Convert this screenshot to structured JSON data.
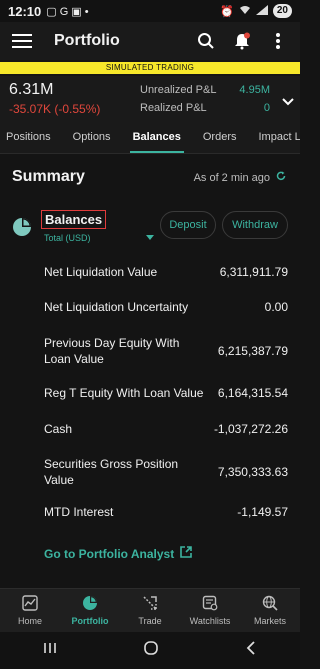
{
  "status_bar": {
    "time": "12:10",
    "battery": "20"
  },
  "app_bar": {
    "title": "Portfolio",
    "icons": [
      "menu-icon",
      "search-icon",
      "bell-icon",
      "more-vert-icon"
    ]
  },
  "banner": {
    "text": "SIMULATED TRADING"
  },
  "account": {
    "net_liq": "6.31M",
    "day_change": "-35.07K (-0.55%)",
    "unrealized_label": "Unrealized P&L",
    "unrealized_value": "4.95M",
    "realized_label": "Realized P&L",
    "realized_value": "0"
  },
  "tabs": [
    "Positions",
    "Options",
    "Balances",
    "Orders",
    "Impact Len"
  ],
  "active_tab": "Balances",
  "summary": {
    "title": "Summary",
    "as_of": "As of 2 min ago"
  },
  "balances": {
    "title": "Balances",
    "currency": "Total (USD)",
    "deposit_label": "Deposit",
    "withdraw_label": "Withdraw",
    "rows": [
      {
        "label": "Net Liquidation Value",
        "value": "6,311,911.79"
      },
      {
        "label": "Net Liquidation Uncertainty",
        "value": "0.00"
      },
      {
        "label": "Previous Day Equity With Loan Value",
        "value": "6,215,387.79"
      },
      {
        "label": "Reg T Equity With Loan Value",
        "value": "6,164,315.54"
      },
      {
        "label": "Cash",
        "value": "-1,037,272.26"
      },
      {
        "label": "Securities Gross Position Value",
        "value": "7,350,333.63"
      },
      {
        "label": "MTD Interest",
        "value": "-1,149.57"
      }
    ],
    "analyst_link": "Go to Portfolio Analyst"
  },
  "bottom_nav": [
    {
      "label": "Home",
      "icon": "home-chart-icon"
    },
    {
      "label": "Portfolio",
      "icon": "portfolio-pie-icon",
      "active": true
    },
    {
      "label": "Trade",
      "icon": "trade-arrows-icon"
    },
    {
      "label": "Watchlists",
      "icon": "watchlists-icon"
    },
    {
      "label": "Markets",
      "icon": "markets-globe-icon"
    }
  ],
  "colors": {
    "accent": "#3cb4a0",
    "negative": "#e0473c",
    "banner": "#f6e72a",
    "background": "#141414"
  }
}
